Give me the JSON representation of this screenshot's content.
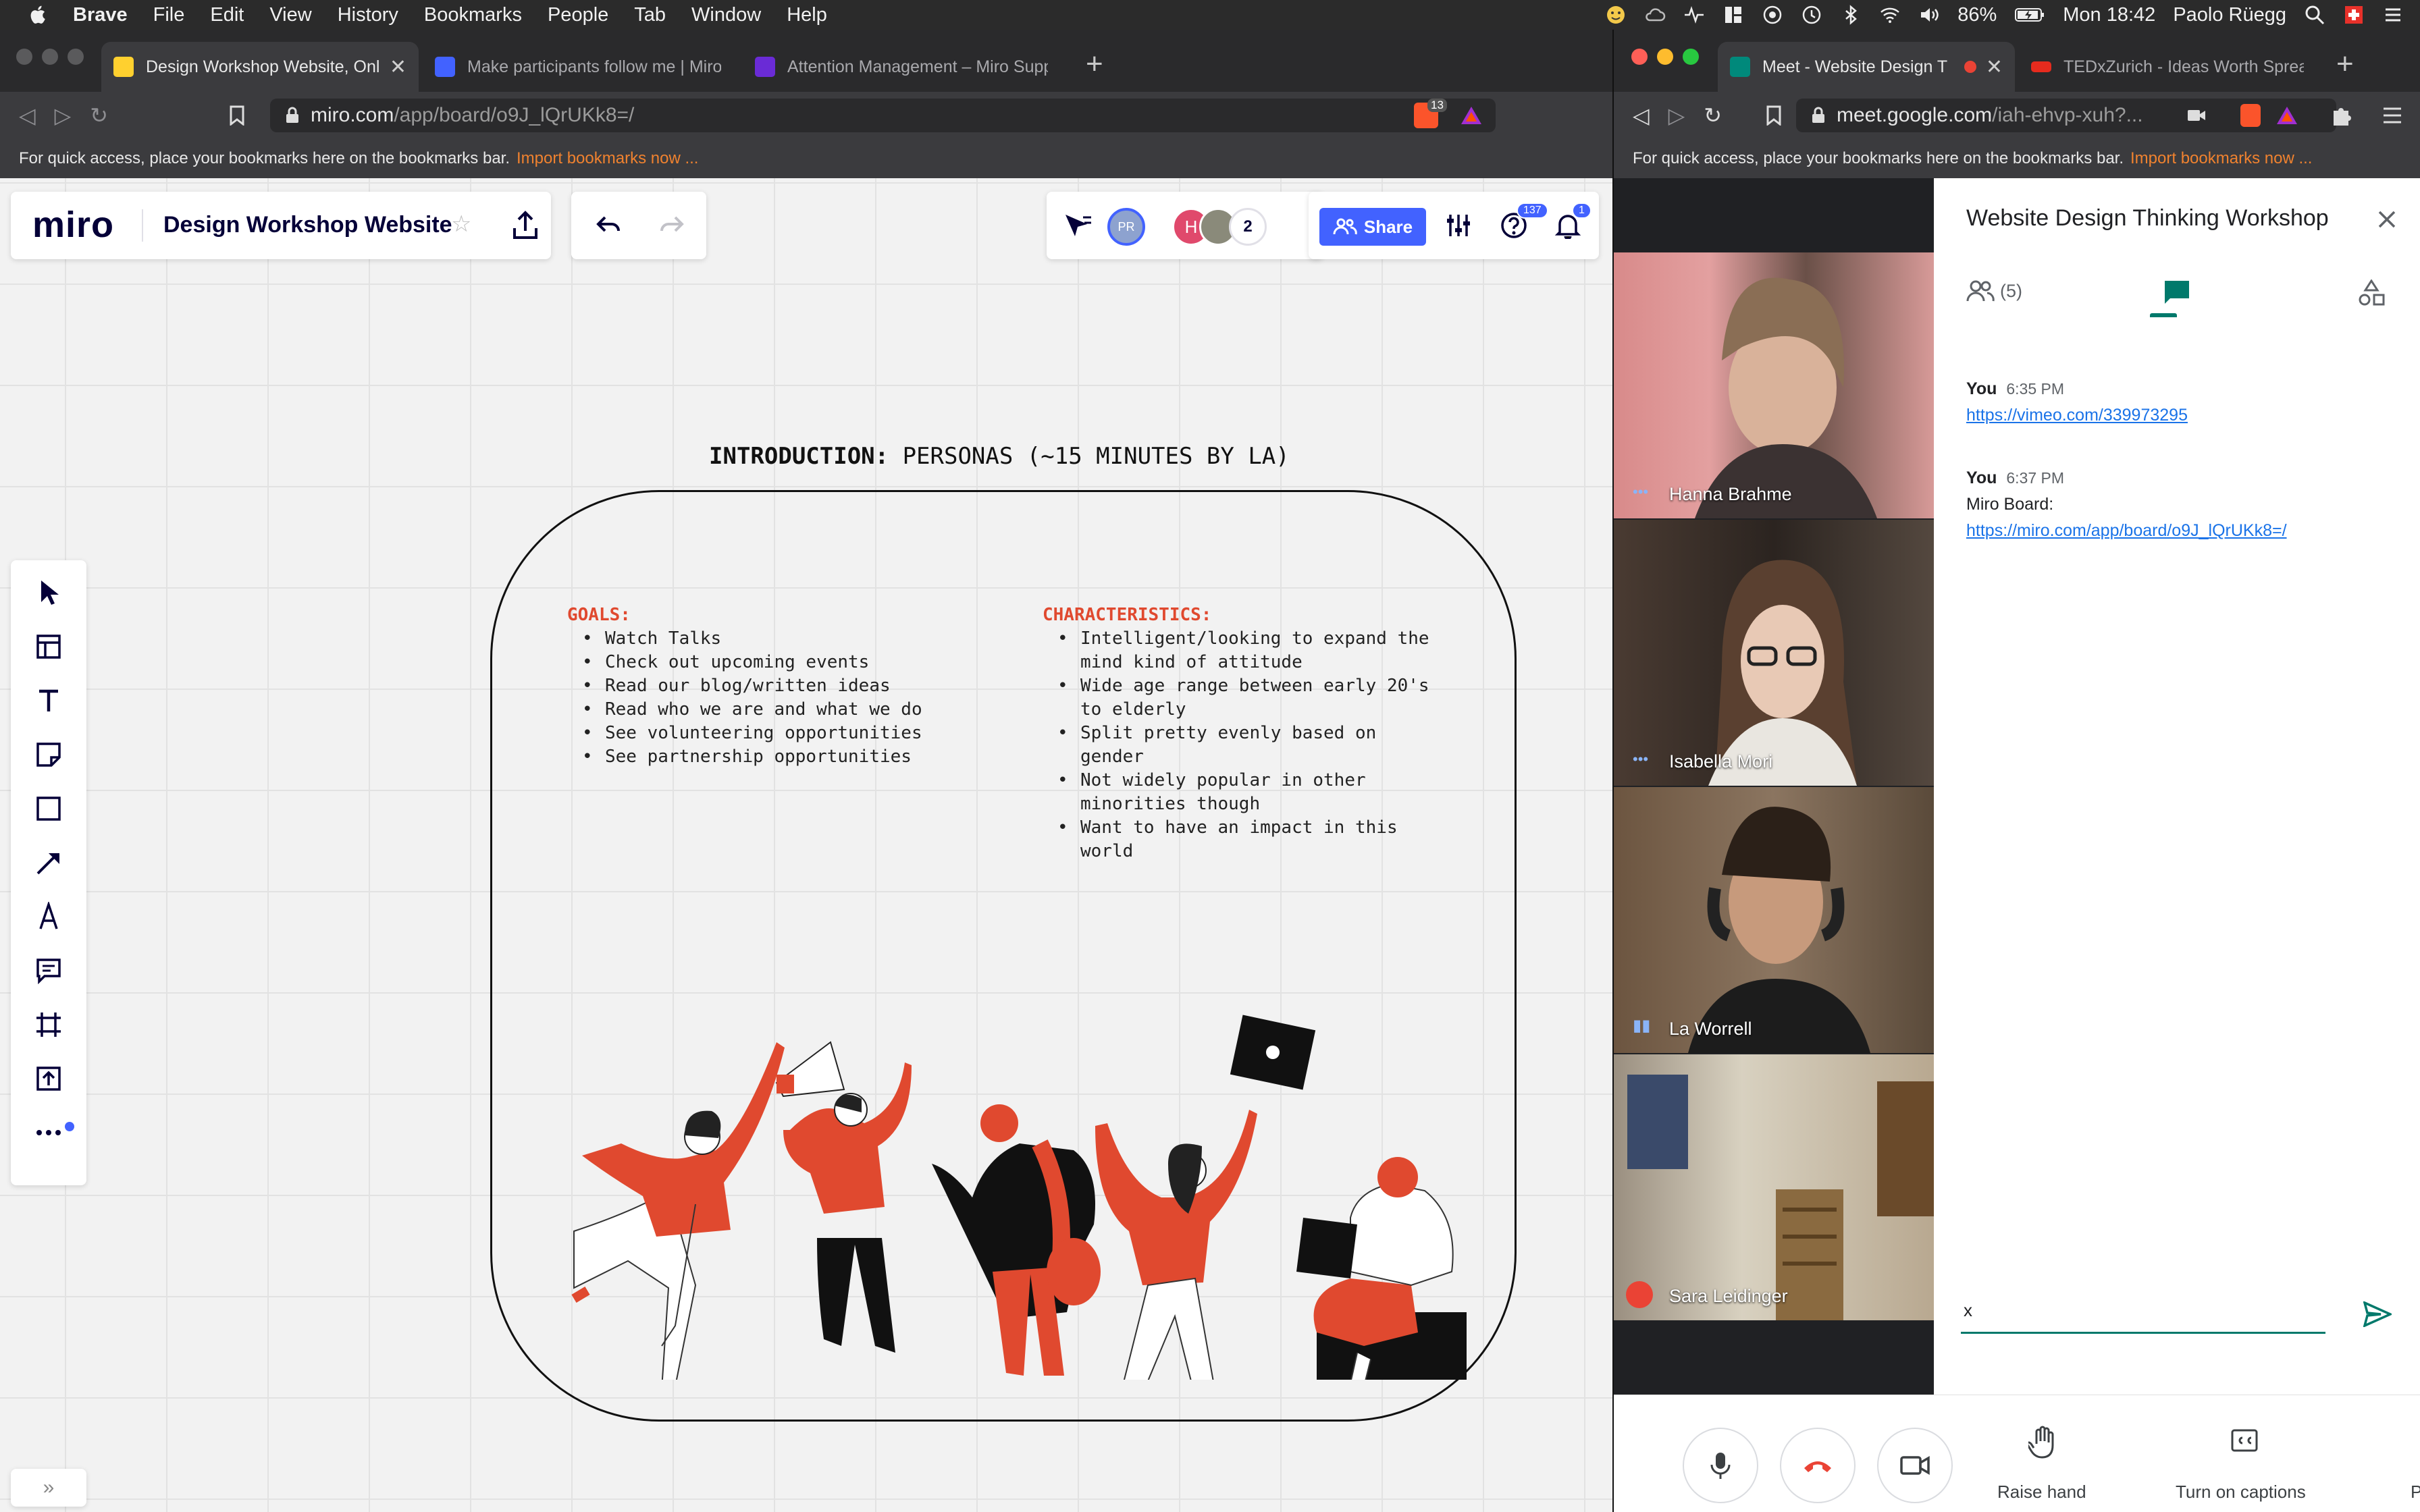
{
  "menubar": {
    "app": "Brave",
    "items": [
      "File",
      "Edit",
      "View",
      "History",
      "Bookmarks",
      "People",
      "Tab",
      "Window",
      "Help"
    ],
    "battery": "86%",
    "clock": "Mon 18:42",
    "user": "Paolo Rüegg"
  },
  "left_browser": {
    "tabs": [
      "Design Workshop Website, Onli",
      "Make participants follow me | Miro",
      "Attention Management – Miro Supp"
    ],
    "url_main": "miro.com",
    "url_path": "/app/board/o9J_lQrUKk8=/",
    "brave_badge": "13",
    "bookmarks_text": "For quick access, place your bookmarks here on the bookmarks bar.",
    "bookmarks_link": "Import bookmarks now ..."
  },
  "miro": {
    "logo": "miro",
    "board_title": "Design Workshop Website",
    "collab_initials": "PR",
    "avatar_h": "H",
    "more_count": "2",
    "share_label": "Share",
    "help_badge": "137",
    "notif_badge": "1",
    "frame": {
      "title_bold": "INTRODUCTION:",
      "title_rest": " PERSONAS (~15 MINUTES BY LA)",
      "goals_header": "GOALS:",
      "goals": [
        "Watch Talks",
        "Check out upcoming events",
        "Read our blog/written ideas",
        "Read who we are and what we do",
        "See volunteering opportunities",
        "See partnership opportunities"
      ],
      "char_header": "CHARACTERISTICS:",
      "characteristics": [
        [
          "Intelligent/looking to expand the",
          "mind kind of attitude"
        ],
        [
          "Wide age range between early 20's",
          "to elderly"
        ],
        [
          "Split pretty evenly based on",
          "gender"
        ],
        [
          "Not widely popular in other",
          "minorities though"
        ],
        [
          "Want to have an impact in this",
          "world"
        ]
      ]
    },
    "colors": {
      "accent_red": "#e0492f",
      "share_blue": "#4262ff"
    }
  },
  "right_browser": {
    "tabs": [
      "Meet - Website Design T",
      "TEDxZurich - Ideas Worth Sprea"
    ],
    "url_main": "meet.google.com",
    "url_path": "/iah-ehvp-xuh?...",
    "bookmarks_text": "For quick access, place your bookmarks here on the bookmarks bar.",
    "bookmarks_link": "Import bookmarks now ..."
  },
  "meet": {
    "meeting_title": "Website Design Thinking Workshop",
    "people_count": "(5)",
    "participants": [
      "Hanna Brahme",
      "Isabella Mori",
      "La Worrell",
      "Sara Leidinger"
    ],
    "messages": [
      {
        "who": "You",
        "time": "6:35 PM",
        "text": "",
        "link": "https://vimeo.com/339973295"
      },
      {
        "who": "You",
        "time": "6:37 PM",
        "text": "Miro Board:",
        "link": "https://miro.com/app/board/o9J_lQrUKk8=/"
      }
    ],
    "input_value": "x",
    "raise_hand": "Raise hand",
    "captions": "Turn on captions",
    "cut_label": "P"
  }
}
